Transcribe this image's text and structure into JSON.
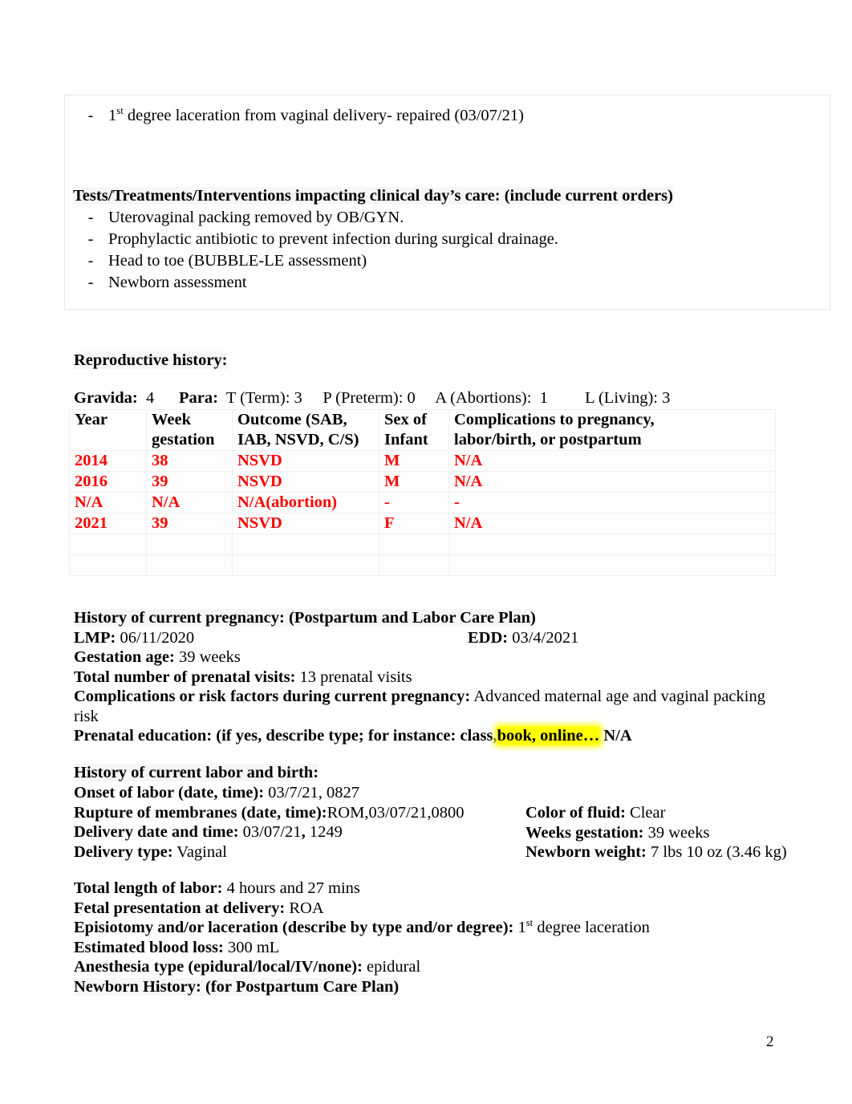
{
  "document": {
    "page_number": "2"
  },
  "top_box": {
    "bullet_dash": "-",
    "laceration_bullet": {
      "prefix": "1",
      "ordinal": "st",
      "rest": " degree laceration from vaginal delivery- repaired (03/07/21)"
    },
    "tests_heading": "Tests/Treatments/Interventions impacting clinical day’s care: (include current orders)",
    "tests_items": [
      "Uterovaginal packing removed by OB/GYN.",
      "Prophylactic antibiotic to prevent infection during surgical drainage.",
      "Head to toe (BUBBLE-LE assessment)",
      "Newborn assessment"
    ]
  },
  "reproductive_history": {
    "heading": "Reproductive history:",
    "gpal": {
      "gravida_label": "Gravida:",
      "gravida_value": "4",
      "para_label": "Para:",
      "term_label": "T (Term):",
      "term_value": "3",
      "preterm_label": "P (Preterm):",
      "preterm_value": "0",
      "abortions_label": "A (Abortions):",
      "abortions_value": "1",
      "living_label": "L (Living):",
      "living_value": "3"
    },
    "table": {
      "headers": [
        "Year",
        "Week gestation",
        "Outcome (SAB, IAB, NSVD, C/S)",
        "Sex of Infant",
        "Complications to pregnancy, labor/birth, or postpartum"
      ],
      "header_lines": [
        [
          "Year",
          ""
        ],
        [
          "Week",
          "gestation"
        ],
        [
          "Outcome (SAB,",
          "IAB, NSVD, C/S)"
        ],
        [
          "Sex of",
          "Infant"
        ],
        [
          "Complications to pregnancy,",
          "labor/birth, or postpartum"
        ]
      ],
      "rows": [
        {
          "year": "2014",
          "week": "38",
          "outcome": "NSVD",
          "sex": "M",
          "complications": "N/A"
        },
        {
          "year": "2016",
          "week": "39",
          "outcome": "NSVD",
          "sex": "M",
          "complications": "N/A"
        },
        {
          "year": "N/A",
          "week": "N/A",
          "outcome": "N/A(abortion)",
          "sex": "-",
          "complications": "-"
        },
        {
          "year": "2021",
          "week": "39",
          "outcome": "NSVD",
          "sex": "F",
          "complications": "N/A"
        }
      ],
      "empty_rows": 2,
      "data_color": "#ff0000"
    }
  },
  "current_pregnancy": {
    "heading": "History of current pregnancy: (Postpartum and Labor Care Plan)",
    "lmp_label": "LMP:",
    "lmp_value": "06/11/2020",
    "edd_label": "EDD:",
    "edd_value": "03/4/2021",
    "gestation_age_label": "Gestation age:",
    "gestation_age_value": "39 weeks",
    "prenatal_visits_label": "Total number of prenatal visits:",
    "prenatal_visits_value": "13 prenatal visits",
    "complications_label": "Complications or risk factors during current pregnancy:",
    "complications_value": "Advanced maternal age and vaginal packing risk",
    "prenatal_education_label_a": "Prenatal education: (if yes, describe type; for instance: class,",
    "prenatal_education_label_b": "book, online…",
    "prenatal_education_value": "N/A",
    "highlight_color": "#ffff00"
  },
  "labor_and_birth": {
    "heading": "History of current labor and birth:",
    "onset_label": "Onset of labor (date, time):",
    "onset_value": "03/7/21, 0827",
    "rom_label": "Rupture of membranes (date, time):",
    "rom_value": "ROM,03/07/21,0800",
    "color_fluid_label": "Color of fluid:",
    "color_fluid_value": "Clear",
    "delivery_datetime_label": "Delivery date and time:",
    "delivery_datetime_value_a": "03/07/21",
    "delivery_datetime_comma": ",",
    "delivery_datetime_value_b": " 1249",
    "weeks_gestation_label": "Weeks gestation:",
    "weeks_gestation_value": "39 weeks",
    "delivery_type_label": "Delivery type:",
    "delivery_type_value": "Vaginal",
    "newborn_weight_label": "Newborn weight:",
    "newborn_weight_value": "7 lbs 10 oz (3.46 kg)",
    "total_length_label": "Total length of labor:",
    "total_length_value": "4 hours and 27 mins",
    "fetal_presentation_label": "Fetal presentation at delivery:",
    "fetal_presentation_value": "ROA",
    "episiotomy_label": "Episiotomy and/or laceration (describe by type and/or degree):",
    "episiotomy_value_prefix": "1",
    "episiotomy_value_ordinal": "st",
    "episiotomy_value_rest": " degree laceration",
    "blood_loss_label": "Estimated blood loss:",
    "blood_loss_value": "300 mL",
    "anesthesia_label": "Anesthesia type (epidural/local/IV/none):",
    "anesthesia_value": "epidural",
    "newborn_history_heading": "Newborn History: (for Postpartum Care Plan)"
  }
}
